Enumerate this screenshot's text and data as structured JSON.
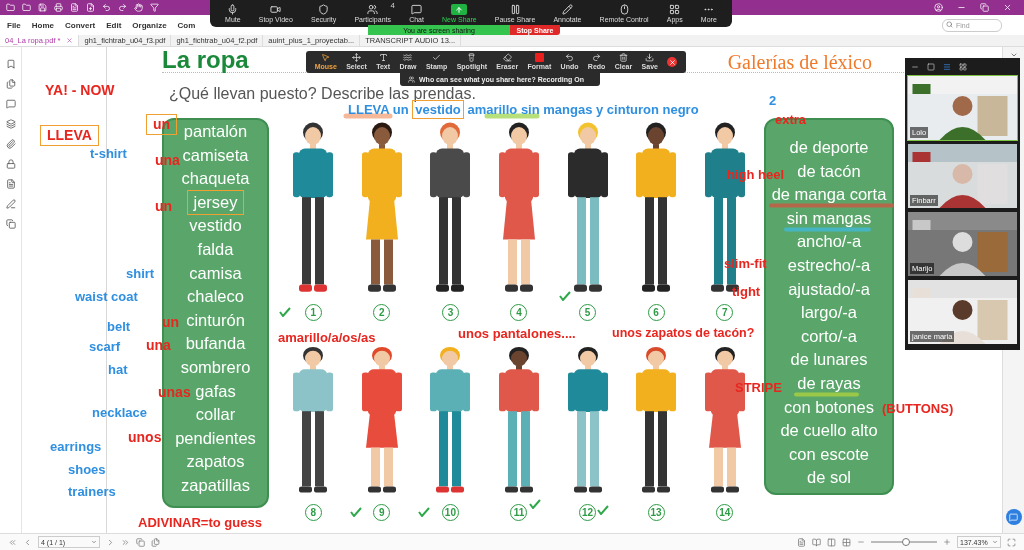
{
  "app": {
    "menu": [
      "File",
      "Home",
      "Convert",
      "Edit",
      "Organize",
      "Com"
    ],
    "find": {
      "placeholder": "Find"
    },
    "tabs": [
      {
        "label": "04_La ropa.pdf *",
        "selected": true
      },
      {
        "label": "gh1_fichtrab_u04_f3.pdf",
        "selected": false
      },
      {
        "label": "gh1_fichtrab_u04_f2.pdf",
        "selected": false
      },
      {
        "label": "auint_plus_1_proyectab...",
        "selected": false
      },
      {
        "label": "TRANSCRIPT AUDIO 13...",
        "selected": false
      }
    ]
  },
  "zoom_toolbar": {
    "items": [
      "Mute",
      "Stop Video",
      "Security",
      "Participants",
      "Chat",
      "New Share",
      "Pause Share",
      "Annotate",
      "Remote Control",
      "Apps",
      "More"
    ],
    "participants_count": "4",
    "sharing_banner": "You are screen sharing",
    "stop_share": "Stop Share"
  },
  "annotate_toolbar": {
    "tools": [
      {
        "label": "Mouse",
        "selected": true
      },
      {
        "label": "Select",
        "selected": false
      },
      {
        "label": "Text",
        "selected": false
      },
      {
        "label": "Draw",
        "selected": false
      },
      {
        "label": "Stamp",
        "selected": false
      },
      {
        "label": "Spotlight",
        "selected": false
      },
      {
        "label": "Eraser",
        "selected": false
      },
      {
        "label": "Format",
        "selected": false
      },
      {
        "label": "Undo",
        "selected": false
      },
      {
        "label": "Redo",
        "selected": false
      },
      {
        "label": "Clear",
        "selected": false
      },
      {
        "label": "Save",
        "selected": false
      }
    ],
    "notice": "Who can see what you share here? Recording On"
  },
  "page": {
    "title": "La ropa",
    "section": "Galerías de léxico",
    "question": "¿Qué llevan puesto? Describe las prendas.",
    "garments": [
      {
        "text": "pantalón",
        "boxed": false
      },
      {
        "text": "camiseta",
        "boxed": false
      },
      {
        "text": "chaqueta",
        "boxed": false
      },
      {
        "text": "jersey",
        "boxed": true
      },
      {
        "text": "vestido",
        "boxed": false
      },
      {
        "text": "falda",
        "boxed": false
      },
      {
        "text": "camisa",
        "boxed": false
      },
      {
        "text": "chaleco",
        "boxed": false
      },
      {
        "text": "cinturón",
        "boxed": false
      },
      {
        "text": "bufanda",
        "boxed": false
      },
      {
        "text": "sombrero",
        "boxed": false
      },
      {
        "text": "gafas",
        "boxed": false
      },
      {
        "text": "collar",
        "boxed": false
      },
      {
        "text": "pendientes",
        "boxed": false
      },
      {
        "text": "zapatos",
        "boxed": false
      },
      {
        "text": "zapatillas",
        "boxed": false
      }
    ],
    "descriptors": [
      "de deporte",
      "de tacón",
      "de manga corta",
      "sin mangas",
      "ancho/-a",
      "estrecho/-a",
      "ajustado/-a",
      "largo/-a",
      "corto/-a",
      "de lunares",
      "de rayas",
      "con botones",
      "de cuello alto",
      "con escote",
      "de sol"
    ],
    "figures": [
      {
        "number": "1",
        "checked": true
      },
      {
        "number": "2",
        "checked": false
      },
      {
        "number": "3",
        "checked": false
      },
      {
        "number": "4",
        "checked": false
      },
      {
        "number": "5",
        "checked": true
      },
      {
        "number": "6",
        "checked": false
      },
      {
        "number": "7",
        "checked": false
      },
      {
        "number": "8",
        "checked": false
      },
      {
        "number": "9",
        "checked": true
      },
      {
        "number": "10",
        "checked": true
      },
      {
        "number": "11",
        "checked": true
      },
      {
        "number": "12",
        "checked": true
      },
      {
        "number": "13",
        "checked": false
      },
      {
        "number": "14",
        "checked": false
      }
    ]
  },
  "annotations": [
    {
      "text": "YA! -  NOW",
      "color": "#e8261f",
      "boxed": false
    },
    {
      "text": "LLEVA",
      "color": "#e8261f",
      "boxed": true
    },
    {
      "text": "t-shirt",
      "color": "#2f8fe0",
      "boxed": false
    },
    {
      "text": "un",
      "color": "#e8261f",
      "boxed": true
    },
    {
      "text": "una",
      "color": "#e8261f",
      "boxed": false
    },
    {
      "text": "un",
      "color": "#e8261f",
      "boxed": false
    },
    {
      "text": "shirt",
      "color": "#2f8fe0",
      "boxed": false
    },
    {
      "text": "waist coat",
      "color": "#2f8fe0",
      "boxed": false
    },
    {
      "text": "belt",
      "color": "#2f8fe0",
      "boxed": false
    },
    {
      "text": "un",
      "color": "#e8261f",
      "boxed": false
    },
    {
      "text": "scarf",
      "color": "#2f8fe0",
      "boxed": false
    },
    {
      "text": "una",
      "color": "#e8261f",
      "boxed": false
    },
    {
      "text": "hat",
      "color": "#2f8fe0",
      "boxed": false
    },
    {
      "text": "unas",
      "color": "#e8261f",
      "boxed": false
    },
    {
      "text": "necklace",
      "color": "#2f8fe0",
      "boxed": false
    },
    {
      "text": "unos",
      "color": "#e8261f",
      "boxed": false
    },
    {
      "text": "earrings",
      "color": "#2f8fe0",
      "boxed": false
    },
    {
      "text": "shoes",
      "color": "#2f8fe0",
      "boxed": false
    },
    {
      "text": "trainers",
      "color": "#2f8fe0",
      "boxed": false
    },
    {
      "text": "ADIVINAR=to guess",
      "color": "#e8261f",
      "boxed": false
    },
    {
      "segments": [
        {
          "text": "LLEVA un ",
          "boxed": false
        },
        {
          "text": "vestido",
          "boxed": true
        },
        {
          "text": " amarillo sin mangas y cinturon negro",
          "boxed": false
        }
      ],
      "color": "#2f8fe0",
      "boxed": false
    },
    {
      "text": "2",
      "color": "#2f8fe0",
      "boxed": false
    },
    {
      "text": "extra",
      "color": "#e8261f",
      "boxed": false
    },
    {
      "text": "high heel",
      "color": "#e8261f",
      "boxed": false
    },
    {
      "text": "slim-fit",
      "color": "#e8261f",
      "boxed": false
    },
    {
      "text": "tight",
      "color": "#e8261f",
      "boxed": false
    },
    {
      "text": "amarillo/a/os/as",
      "color": "#e8261f",
      "boxed": false
    },
    {
      "text": "unos pantalones....",
      "color": "#e8261f",
      "boxed": false
    },
    {
      "text": "unos zapatos de tacón?",
      "color": "#e8261f",
      "boxed": false
    },
    {
      "text": "STRIPE",
      "color": "#e8261f",
      "boxed": false
    },
    {
      "text": "(BUTTONS)",
      "color": "#e8261f",
      "boxed": false
    }
  ],
  "video": {
    "participants": [
      {
        "name": "Lolo",
        "speaking": true
      },
      {
        "name": "Finbarr",
        "speaking": false
      },
      {
        "name": "Marijo",
        "speaking": false
      },
      {
        "name": "janice maria",
        "speaking": false
      }
    ]
  },
  "status_bar": {
    "page": "4 (1 / 1)",
    "zoom": "137.43%",
    "zoom_slider": {
      "level": 0.53
    }
  }
}
